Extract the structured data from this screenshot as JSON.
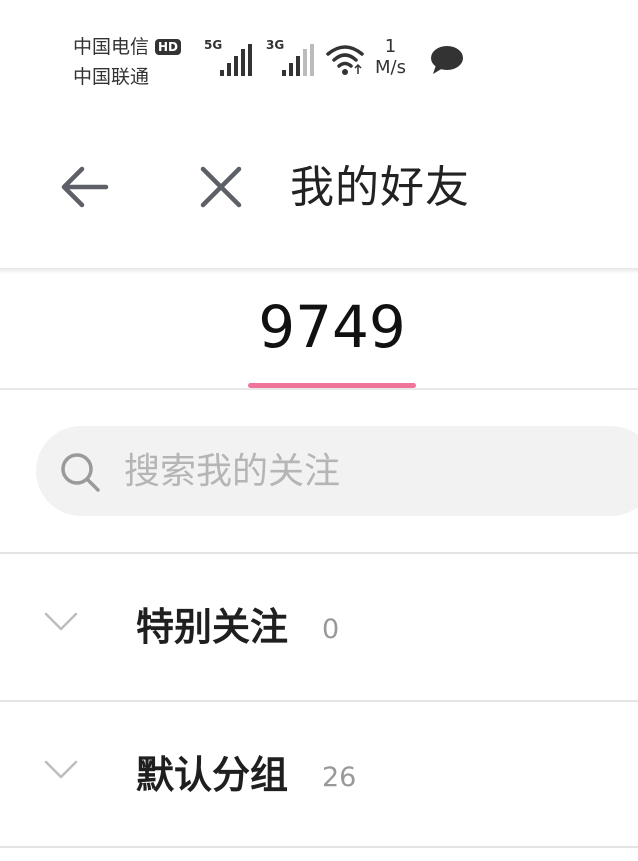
{
  "status_bar": {
    "carrier_1": "中国电信",
    "hd_badge": "HD",
    "carrier_2": "中国联通",
    "network_1": "5G",
    "network_2": "3G",
    "speed_value": "1",
    "speed_unit": "M/s",
    "icons": [
      "signal-bars-icon",
      "wifi-icon",
      "message-bubble-icon"
    ]
  },
  "header": {
    "title": "我的好友",
    "icons": [
      "back-arrow-icon",
      "close-icon"
    ]
  },
  "tab": {
    "count": "9749",
    "indicator_color": "#f0739a"
  },
  "search": {
    "placeholder": "搜索我的关注",
    "value": ""
  },
  "groups": [
    {
      "name": "特别关注",
      "count": "0"
    },
    {
      "name": "默认分组",
      "count": "26"
    }
  ]
}
